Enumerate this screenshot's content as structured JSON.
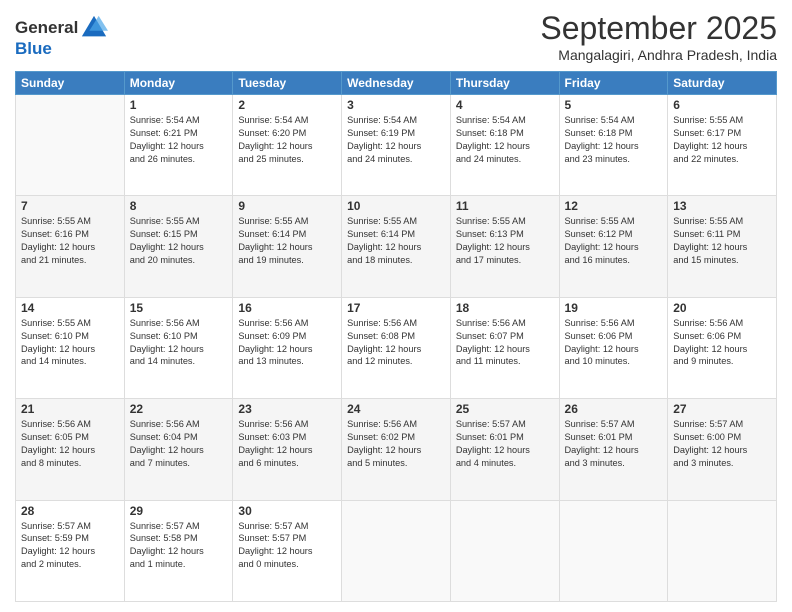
{
  "logo": {
    "line1": "General",
    "line2": "Blue"
  },
  "title": "September 2025",
  "location": "Mangalagiri, Andhra Pradesh, India",
  "days_of_week": [
    "Sunday",
    "Monday",
    "Tuesday",
    "Wednesday",
    "Thursday",
    "Friday",
    "Saturday"
  ],
  "weeks": [
    [
      {
        "day": "",
        "info": ""
      },
      {
        "day": "1",
        "info": "Sunrise: 5:54 AM\nSunset: 6:21 PM\nDaylight: 12 hours\nand 26 minutes."
      },
      {
        "day": "2",
        "info": "Sunrise: 5:54 AM\nSunset: 6:20 PM\nDaylight: 12 hours\nand 25 minutes."
      },
      {
        "day": "3",
        "info": "Sunrise: 5:54 AM\nSunset: 6:19 PM\nDaylight: 12 hours\nand 24 minutes."
      },
      {
        "day": "4",
        "info": "Sunrise: 5:54 AM\nSunset: 6:18 PM\nDaylight: 12 hours\nand 24 minutes."
      },
      {
        "day": "5",
        "info": "Sunrise: 5:54 AM\nSunset: 6:18 PM\nDaylight: 12 hours\nand 23 minutes."
      },
      {
        "day": "6",
        "info": "Sunrise: 5:55 AM\nSunset: 6:17 PM\nDaylight: 12 hours\nand 22 minutes."
      }
    ],
    [
      {
        "day": "7",
        "info": "Sunrise: 5:55 AM\nSunset: 6:16 PM\nDaylight: 12 hours\nand 21 minutes."
      },
      {
        "day": "8",
        "info": "Sunrise: 5:55 AM\nSunset: 6:15 PM\nDaylight: 12 hours\nand 20 minutes."
      },
      {
        "day": "9",
        "info": "Sunrise: 5:55 AM\nSunset: 6:14 PM\nDaylight: 12 hours\nand 19 minutes."
      },
      {
        "day": "10",
        "info": "Sunrise: 5:55 AM\nSunset: 6:14 PM\nDaylight: 12 hours\nand 18 minutes."
      },
      {
        "day": "11",
        "info": "Sunrise: 5:55 AM\nSunset: 6:13 PM\nDaylight: 12 hours\nand 17 minutes."
      },
      {
        "day": "12",
        "info": "Sunrise: 5:55 AM\nSunset: 6:12 PM\nDaylight: 12 hours\nand 16 minutes."
      },
      {
        "day": "13",
        "info": "Sunrise: 5:55 AM\nSunset: 6:11 PM\nDaylight: 12 hours\nand 15 minutes."
      }
    ],
    [
      {
        "day": "14",
        "info": "Sunrise: 5:55 AM\nSunset: 6:10 PM\nDaylight: 12 hours\nand 14 minutes."
      },
      {
        "day": "15",
        "info": "Sunrise: 5:56 AM\nSunset: 6:10 PM\nDaylight: 12 hours\nand 14 minutes."
      },
      {
        "day": "16",
        "info": "Sunrise: 5:56 AM\nSunset: 6:09 PM\nDaylight: 12 hours\nand 13 minutes."
      },
      {
        "day": "17",
        "info": "Sunrise: 5:56 AM\nSunset: 6:08 PM\nDaylight: 12 hours\nand 12 minutes."
      },
      {
        "day": "18",
        "info": "Sunrise: 5:56 AM\nSunset: 6:07 PM\nDaylight: 12 hours\nand 11 minutes."
      },
      {
        "day": "19",
        "info": "Sunrise: 5:56 AM\nSunset: 6:06 PM\nDaylight: 12 hours\nand 10 minutes."
      },
      {
        "day": "20",
        "info": "Sunrise: 5:56 AM\nSunset: 6:06 PM\nDaylight: 12 hours\nand 9 minutes."
      }
    ],
    [
      {
        "day": "21",
        "info": "Sunrise: 5:56 AM\nSunset: 6:05 PM\nDaylight: 12 hours\nand 8 minutes."
      },
      {
        "day": "22",
        "info": "Sunrise: 5:56 AM\nSunset: 6:04 PM\nDaylight: 12 hours\nand 7 minutes."
      },
      {
        "day": "23",
        "info": "Sunrise: 5:56 AM\nSunset: 6:03 PM\nDaylight: 12 hours\nand 6 minutes."
      },
      {
        "day": "24",
        "info": "Sunrise: 5:56 AM\nSunset: 6:02 PM\nDaylight: 12 hours\nand 5 minutes."
      },
      {
        "day": "25",
        "info": "Sunrise: 5:57 AM\nSunset: 6:01 PM\nDaylight: 12 hours\nand 4 minutes."
      },
      {
        "day": "26",
        "info": "Sunrise: 5:57 AM\nSunset: 6:01 PM\nDaylight: 12 hours\nand 3 minutes."
      },
      {
        "day": "27",
        "info": "Sunrise: 5:57 AM\nSunset: 6:00 PM\nDaylight: 12 hours\nand 3 minutes."
      }
    ],
    [
      {
        "day": "28",
        "info": "Sunrise: 5:57 AM\nSunset: 5:59 PM\nDaylight: 12 hours\nand 2 minutes."
      },
      {
        "day": "29",
        "info": "Sunrise: 5:57 AM\nSunset: 5:58 PM\nDaylight: 12 hours\nand 1 minute."
      },
      {
        "day": "30",
        "info": "Sunrise: 5:57 AM\nSunset: 5:57 PM\nDaylight: 12 hours\nand 0 minutes."
      },
      {
        "day": "",
        "info": ""
      },
      {
        "day": "",
        "info": ""
      },
      {
        "day": "",
        "info": ""
      },
      {
        "day": "",
        "info": ""
      }
    ]
  ]
}
